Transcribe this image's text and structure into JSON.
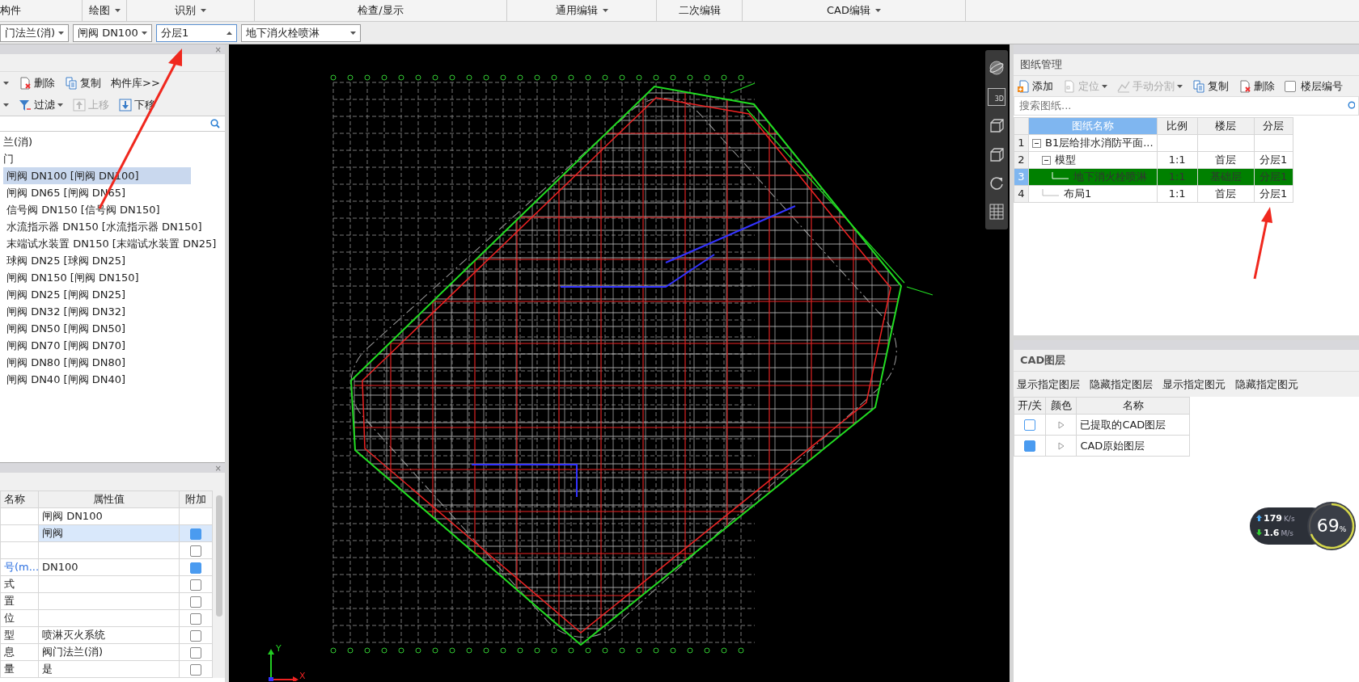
{
  "ribbon_tabs": [
    {
      "label": "构件",
      "has_menu": false
    },
    {
      "label": "绘图",
      "has_menu": true
    },
    {
      "label": "识别",
      "has_menu": true
    },
    {
      "label": "检查/显示",
      "has_menu": false
    },
    {
      "label": "通用编辑",
      "has_menu": true
    },
    {
      "label": "二次编辑",
      "has_menu": false
    },
    {
      "label": "CAD编辑",
      "has_menu": true
    }
  ],
  "selectors": [
    {
      "value": "门法兰(消)",
      "kind": "dropdown"
    },
    {
      "value": "闸阀 DN100",
      "kind": "dropdown"
    },
    {
      "value": "分层1",
      "kind": "spinner"
    },
    {
      "value": "地下消火栓喷淋",
      "kind": "dropdown"
    }
  ],
  "component_panel": {
    "close": "×",
    "toolbar_rows": [
      [
        {
          "label": "删除",
          "kind": "delete",
          "disabled": false,
          "has_menu": false
        },
        {
          "label": "复制",
          "kind": "copy",
          "disabled": false,
          "has_menu": false
        },
        {
          "label": "构件库>>",
          "kind": "text",
          "disabled": false,
          "has_menu": false
        }
      ],
      [
        {
          "label": "过滤",
          "kind": "filter",
          "disabled": false,
          "has_menu": true
        },
        {
          "label": "上移",
          "kind": "up",
          "disabled": true,
          "has_menu": false
        },
        {
          "label": "下移",
          "kind": "down",
          "disabled": false,
          "has_menu": false
        }
      ]
    ],
    "tree": [
      {
        "label": "兰(消)",
        "selected": false,
        "children": [
          {
            "label": "门",
            "selected": false,
            "children": [
              {
                "label": "闸阀 DN100 [闸阀 DN100]",
                "selected": true
              },
              {
                "label": "闸阀 DN65 [闸阀 DN65]",
                "selected": false
              },
              {
                "label": "信号阀 DN150 [信号阀 DN150]",
                "selected": false
              },
              {
                "label": "水流指示器 DN150 [水流指示器 DN150]",
                "selected": false
              },
              {
                "label": "末端试水装置 DN150 [末端试水装置 DN25]",
                "selected": false
              },
              {
                "label": "球阀 DN25 [球阀 DN25]",
                "selected": false
              },
              {
                "label": "闸阀 DN150 [闸阀 DN150]",
                "selected": false
              },
              {
                "label": "闸阀 DN25 [闸阀 DN25]",
                "selected": false
              },
              {
                "label": "闸阀 DN32 [闸阀 DN32]",
                "selected": false
              },
              {
                "label": "闸阀 DN50 [闸阀 DN50]",
                "selected": false
              },
              {
                "label": "闸阀 DN70 [闸阀 DN70]",
                "selected": false
              },
              {
                "label": "闸阀 DN80 [闸阀 DN80]",
                "selected": false
              },
              {
                "label": "闸阀 DN40 [闸阀 DN40]",
                "selected": false
              }
            ]
          }
        ]
      }
    ]
  },
  "property_panel": {
    "close": "×",
    "columns": [
      "名称",
      "属性值",
      "附加"
    ],
    "rows": [
      {
        "name": "",
        "value": "闸阀 DN100",
        "selected": false
      },
      {
        "name": "",
        "value": "闸阀",
        "extra": true,
        "selected": true
      },
      {
        "name": "",
        "value": "",
        "extra": false,
        "selected": false
      },
      {
        "name": "号(m...",
        "value": "DN100",
        "extra": true,
        "selected": false,
        "emphasis": true
      },
      {
        "name": "式",
        "value": "",
        "extra": false,
        "selected": false,
        "emphasis": false
      },
      {
        "name": "置",
        "value": "",
        "extra": false,
        "selected": false,
        "emphasis": false
      },
      {
        "name": "位",
        "value": "",
        "extra": false,
        "selected": false,
        "emphasis": false
      },
      {
        "name": "型",
        "value": "喷淋灭火系统",
        "extra": false,
        "selected": false,
        "emphasis": false
      },
      {
        "name": "息",
        "value": "阀门法兰(消)",
        "extra": false,
        "selected": false,
        "emphasis": false
      },
      {
        "name": "量",
        "value": "是",
        "extra": false,
        "selected": false,
        "emphasis": false
      }
    ]
  },
  "canvas": {
    "view_tools": [
      {
        "kind": "orbit"
      },
      {
        "kind": "view3d",
        "label": "3D"
      },
      {
        "kind": "cube"
      },
      {
        "kind": "cube"
      },
      {
        "kind": "rotate"
      },
      {
        "kind": "grid"
      }
    ],
    "axis": {
      "y_label": "Y",
      "x_label": "X"
    }
  },
  "drawings_panel": {
    "title": "图纸管理",
    "toolbar": [
      {
        "label": "添加",
        "kind": "add",
        "disabled": false,
        "has_menu": false
      },
      {
        "label": "定位",
        "kind": "locate",
        "disabled": true,
        "has_menu": true
      },
      {
        "label": "手动分割",
        "kind": "split",
        "disabled": true,
        "has_menu": true
      },
      {
        "label": "复制",
        "kind": "copy",
        "disabled": false,
        "has_menu": false
      },
      {
        "label": "删除",
        "kind": "delete",
        "disabled": false,
        "has_menu": false
      }
    ],
    "floor_numbering": {
      "label": "楼层编号",
      "checked": false
    },
    "search": {
      "placeholder": "搜索图纸..."
    },
    "columns": [
      "图纸名称",
      "比例",
      "楼层",
      "分层"
    ],
    "rows": [
      {
        "num": "1",
        "name": "B1层给排水消防平面...",
        "scale": "",
        "floor": "",
        "layer": "",
        "expanded": true,
        "selected": false,
        "children": [
          {
            "num": "2",
            "name": "模型",
            "scale": "1:1",
            "floor": "首层",
            "layer": "分层1",
            "expanded": true,
            "selected": false,
            "children": [
              {
                "num": "3",
                "name": "地下消火栓喷淋",
                "scale": "1:1",
                "floor": "基础层",
                "layer": "分层1",
                "selected": true
              }
            ]
          },
          {
            "num": "4",
            "name": "布局1",
            "scale": "1:1",
            "floor": "首层",
            "layer": "分层1",
            "selected": false
          }
        ]
      }
    ]
  },
  "layers_panel": {
    "title": "CAD图层",
    "actions": [
      "显示指定图层",
      "隐藏指定图层",
      "显示指定图元",
      "隐藏指定图元"
    ],
    "columns": [
      "开/关",
      "颜色",
      "名称"
    ],
    "rows": [
      {
        "name": "已提取的CAD图层",
        "on": false
      },
      {
        "name": "CAD原始图层",
        "on": true
      }
    ]
  },
  "network_widget": {
    "upload": "179",
    "upload_unit": "K/s",
    "download": "1.6",
    "download_unit": "M/s",
    "percent": "69",
    "percent_sign": "%"
  }
}
